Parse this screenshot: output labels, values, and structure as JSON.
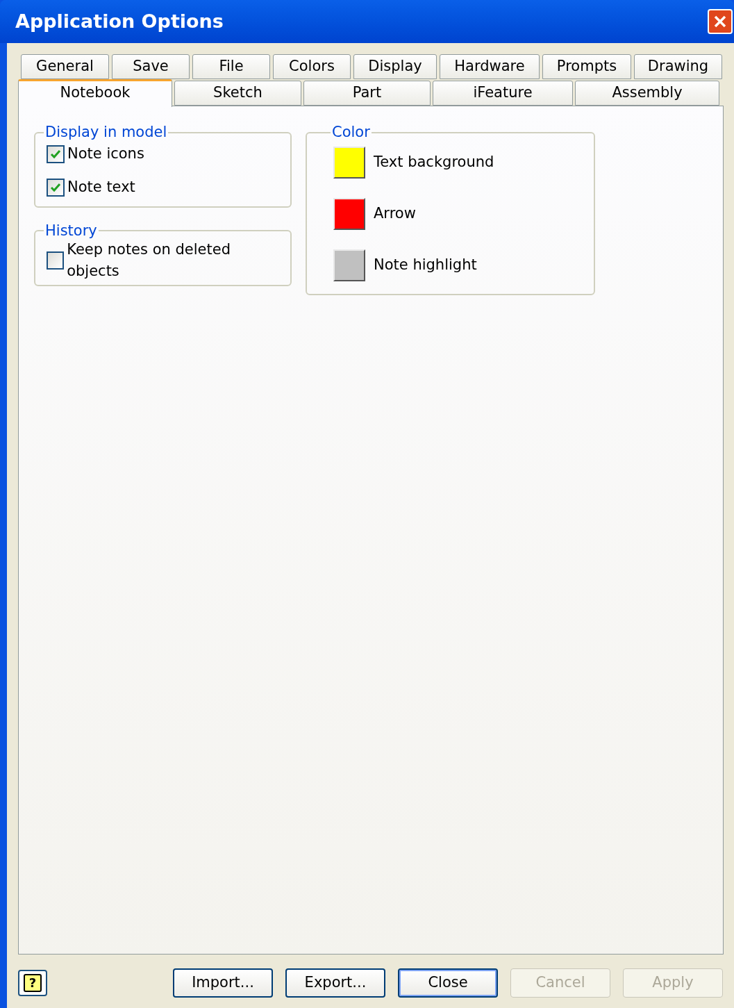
{
  "window": {
    "title": "Application Options"
  },
  "tab_rows": [
    {
      "tabs": [
        {
          "label": "General",
          "selected": false
        },
        {
          "label": "Save",
          "selected": false
        },
        {
          "label": "File",
          "selected": false
        },
        {
          "label": "Colors",
          "selected": false
        },
        {
          "label": "Display",
          "selected": false
        },
        {
          "label": "Hardware",
          "selected": false
        },
        {
          "label": "Prompts",
          "selected": false
        },
        {
          "label": "Drawing",
          "selected": false
        }
      ]
    },
    {
      "tabs": [
        {
          "label": "Notebook",
          "selected": true
        },
        {
          "label": "Sketch",
          "selected": false
        },
        {
          "label": "Part",
          "selected": false
        },
        {
          "label": "iFeature",
          "selected": false
        },
        {
          "label": "Assembly",
          "selected": false
        }
      ]
    }
  ],
  "display_in_model": {
    "title": "Display in model",
    "checkboxes": [
      {
        "label": "Note icons",
        "checked": true
      },
      {
        "label": "Note text",
        "checked": true
      }
    ]
  },
  "history": {
    "title": "History",
    "checkboxes": [
      {
        "label": "Keep notes on deleted objects",
        "checked": false
      }
    ]
  },
  "color": {
    "title": "Color",
    "swatches": [
      {
        "label": "Text background",
        "color": "#ffff00"
      },
      {
        "label": "Arrow",
        "color": "#ff0000"
      },
      {
        "label": "Note highlight",
        "color": "#c0c0c0"
      }
    ]
  },
  "help_button": {
    "label": "?"
  },
  "buttons": [
    {
      "label": "Import...",
      "disabled": false,
      "default": false
    },
    {
      "label": "Export...",
      "disabled": false,
      "default": false
    },
    {
      "label": "Close",
      "disabled": false,
      "default": true
    },
    {
      "label": "Cancel",
      "disabled": true,
      "default": false
    },
    {
      "label": "Apply",
      "disabled": true,
      "default": false
    }
  ]
}
